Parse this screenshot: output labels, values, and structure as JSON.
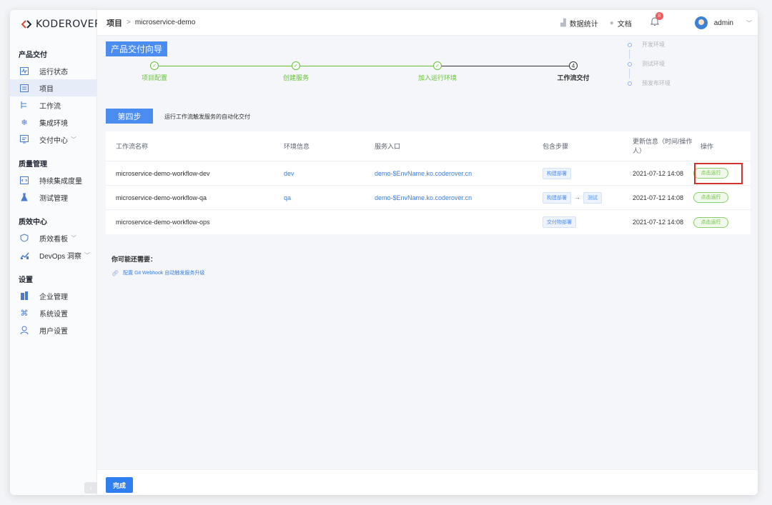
{
  "sidebar": {
    "logo_text": "KODEROVER",
    "groups": [
      {
        "title": "产品交付",
        "items": [
          {
            "label": "运行状态",
            "icon": "pulse-icon"
          },
          {
            "label": "项目",
            "icon": "project-icon",
            "active": true
          },
          {
            "label": "工作流",
            "icon": "workflow-icon"
          },
          {
            "label": "集成环境",
            "icon": "snowflake-icon"
          },
          {
            "label": "交付中心",
            "icon": "delivery-icon",
            "caret": true
          }
        ]
      },
      {
        "title": "质量管理",
        "items": [
          {
            "label": "持续集成度量",
            "icon": "code-icon"
          },
          {
            "label": "测试管理",
            "icon": "flask-icon"
          }
        ]
      },
      {
        "title": "质效中心",
        "items": [
          {
            "label": "质效看板",
            "icon": "shield-icon",
            "caret": true
          },
          {
            "label": "DevOps 洞察",
            "icon": "chart-icon",
            "caret": true
          }
        ]
      },
      {
        "title": "设置",
        "items": [
          {
            "label": "企业管理",
            "icon": "building-icon"
          },
          {
            "label": "系统设置",
            "icon": "command-icon"
          },
          {
            "label": "用户设置",
            "icon": "user-icon"
          }
        ]
      }
    ]
  },
  "header": {
    "breadcrumb_root": "项目",
    "breadcrumb_sep": ">",
    "breadcrumb_current": "microservice-demo",
    "stats_label": "数据统计",
    "docs_label": "文档",
    "notification_count": "8",
    "user_name": "admin"
  },
  "wizard": {
    "title": "产品交付向导",
    "steps": [
      {
        "label": "项目配置",
        "done": true
      },
      {
        "label": "创建服务",
        "done": true
      },
      {
        "label": "加入运行环境",
        "done": true
      },
      {
        "label": "工作流交付",
        "done": false,
        "number": "4"
      }
    ],
    "envs": [
      "开发环境",
      "测试环境",
      "预发布环境"
    ],
    "current_step_tag": "第四步",
    "current_step_desc": "运行工作流触发服务的自动化交付"
  },
  "table": {
    "headers": [
      "工作流名称",
      "环境信息",
      "服务入口",
      "包含步骤",
      "更新信息（时间/操作人）",
      "操作"
    ],
    "rows": [
      {
        "name": "microservice-demo-workflow-dev",
        "env": "dev",
        "entry": "demo-$EnvName.ko.coderover.cn",
        "steps": [
          "构建部署"
        ],
        "updated": "2021-07-12 14:08",
        "action": "点击运行"
      },
      {
        "name": "microservice-demo-workflow-qa",
        "env": "qa",
        "entry": "demo-$EnvName.ko.coderover.cn",
        "steps": [
          "构建部署",
          "测试"
        ],
        "updated": "2021-07-12 14:08",
        "action": "点击运行"
      },
      {
        "name": "microservice-demo-workflow-ops",
        "env": "",
        "entry": "",
        "steps": [
          "交付物部署"
        ],
        "updated": "2021-07-12 14:08",
        "action": "点击运行"
      }
    ]
  },
  "tips": {
    "title": "你可能还需要：",
    "link": "配置 Git Webhook 自动触发服务升级"
  },
  "footer": {
    "done_label": "完成"
  },
  "colors": {
    "primary": "#4a8cf0",
    "success": "#67c23a",
    "highlight": "#d0332c"
  }
}
